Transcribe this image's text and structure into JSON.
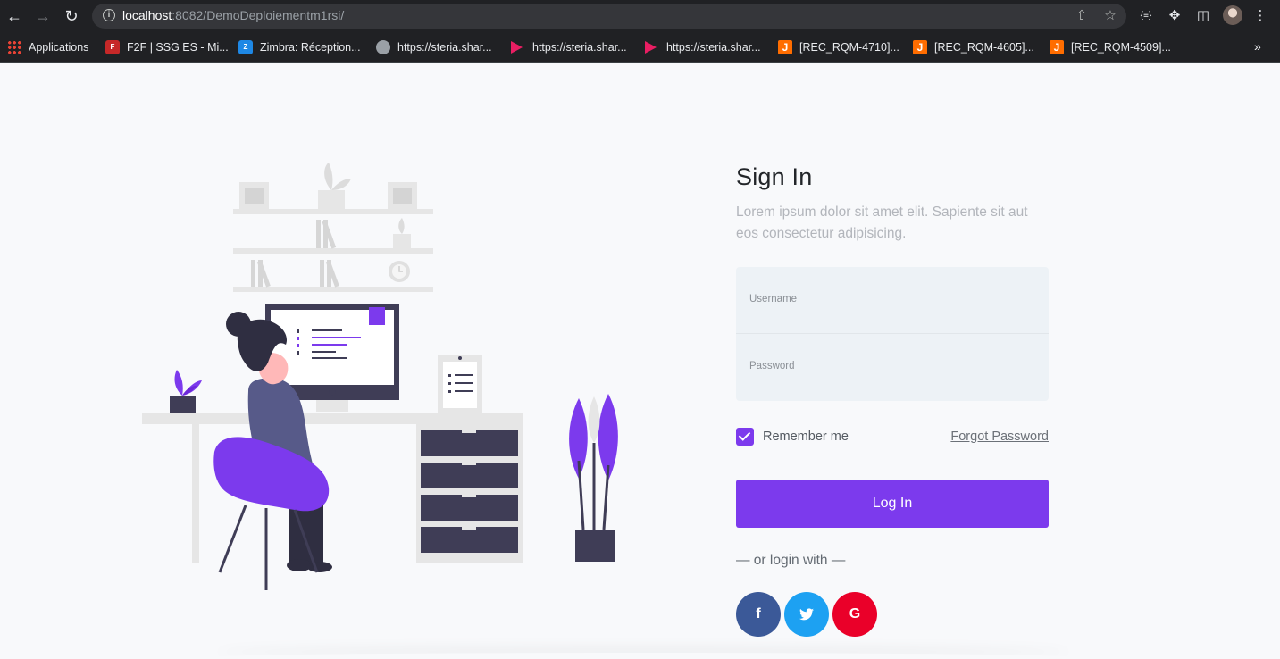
{
  "browser": {
    "url_host": "localhost",
    "url_rest": ":8082/DemoDeploiementm1rsi/",
    "bookmarks": [
      {
        "label": "Applications",
        "icon": "apps-grid-icon"
      },
      {
        "label": "F2F | SSG ES - Mi...",
        "icon": "f2f-icon"
      },
      {
        "label": "Zimbra: Réception...",
        "icon": "zimbra-icon"
      },
      {
        "label": "https://steria.shar...",
        "icon": "globe-icon"
      },
      {
        "label": "https://steria.shar...",
        "icon": "play-icon"
      },
      {
        "label": "https://steria.shar...",
        "icon": "play-icon"
      },
      {
        "label": "[REC_RQM-4710]...",
        "icon": "jira-icon"
      },
      {
        "label": "[REC_RQM-4605]...",
        "icon": "jira-icon"
      },
      {
        "label": "[REC_RQM-4509]...",
        "icon": "jira-icon"
      }
    ]
  },
  "signin": {
    "title": "Sign In",
    "subtitle": "Lorem ipsum dolor sit amet elit. Sapiente sit aut eos consectetur adipisicing.",
    "username_label": "Username",
    "password_label": "Password",
    "remember_label": "Remember me",
    "remember_checked": true,
    "forgot_label": "Forgot Password",
    "login_label": "Log In",
    "or_login_with": "— or login with —",
    "socials": [
      "facebook-icon",
      "twitter-icon",
      "google-icon"
    ]
  },
  "colors": {
    "accent": "#7c3aed",
    "dark": "#3f3d56",
    "facebook": "#3b5998",
    "twitter": "#1da1f2",
    "google": "#ea0029"
  }
}
